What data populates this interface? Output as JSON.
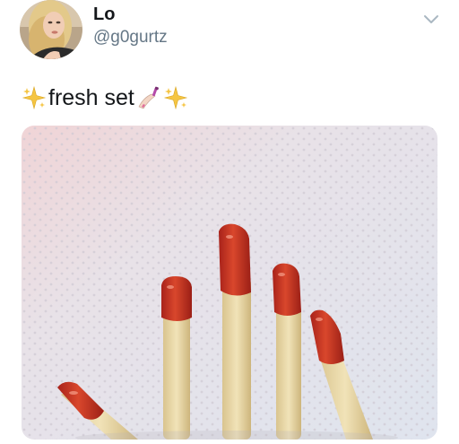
{
  "tweet": {
    "display_name": "Lo",
    "handle": "@g0gurtz",
    "text": "fresh set",
    "emojis": [
      "sparkles-icon",
      "nail-polish-icon",
      "sparkles-icon"
    ],
    "menu_icon": "chevron-down-icon"
  },
  "media": {
    "subject": "french-fries-with-ketchup-tips-on-paper-towel"
  },
  "colors": {
    "name": "#14171a",
    "handle": "#657786",
    "chevron": "#aab8c2",
    "ketchup": "#c2341e",
    "fry": "#e8d8a8",
    "towel": "#e9e6ea"
  }
}
